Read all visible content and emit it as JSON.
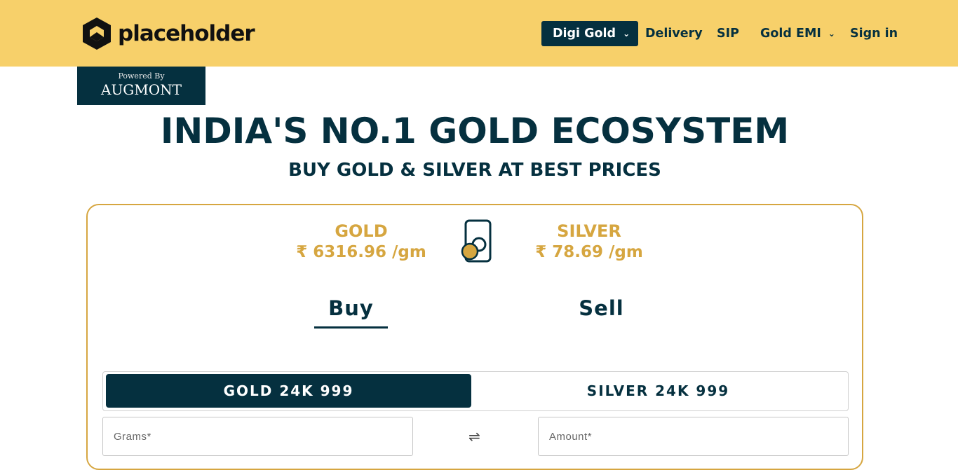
{
  "brand": {
    "name": "placeholder",
    "logo_icon": "hexagon-logo-icon",
    "powered_by": "Powered By",
    "partner": "AUGMONT"
  },
  "nav": {
    "items": [
      {
        "label": "Digi Gold",
        "dropdown": true,
        "active": true
      },
      {
        "label": "Delivery"
      },
      {
        "label": "SIP"
      },
      {
        "label": "Gold EMI",
        "dropdown": true
      },
      {
        "label": "Sign in"
      }
    ]
  },
  "hero": {
    "title": "INDIA'S NO.1 GOLD ECOSYSTEM",
    "subtitle": "BUY GOLD & SILVER AT BEST PRICES"
  },
  "prices": {
    "gold": {
      "label": "GOLD",
      "value": "₹ 6316.96 /gm"
    },
    "silver": {
      "label": "SILVER",
      "value": "₹ 78.69 /gm"
    }
  },
  "tabs": {
    "buy": "Buy",
    "sell": "Sell",
    "active": "buy"
  },
  "metals": {
    "gold": "GOLD 24K 999",
    "silver": "SILVER 24K 999",
    "selected": "gold"
  },
  "form": {
    "grams_placeholder": "Grams*",
    "amount_placeholder": "Amount*",
    "swap_icon": "swap-arrows-icon"
  },
  "colors": {
    "header_bg": "#f7d06a",
    "primary": "#05303f",
    "accent": "#d6a640"
  }
}
